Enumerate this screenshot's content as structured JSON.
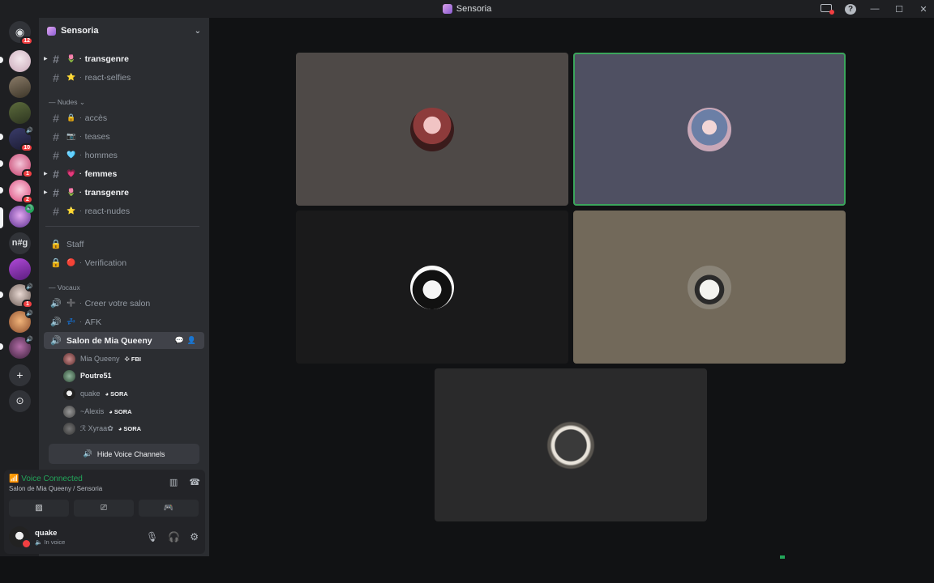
{
  "window": {
    "title": "Sensoria"
  },
  "server": {
    "name": "Sensoria"
  },
  "guild_badges": [
    "12",
    "10",
    "1",
    "2",
    "1"
  ],
  "guild_text_label": "n#g",
  "channels": [
    {
      "name": "transgenre",
      "emoji": "🌷",
      "bold": true,
      "arrow": true
    },
    {
      "name": "react-selfies",
      "emoji": "⭐",
      "bold": false,
      "arrow": false
    }
  ],
  "category_nudes": "Nudes",
  "nudes_channels": [
    {
      "name": "accès",
      "emoji": "🔒",
      "bold": false,
      "arrow": false
    },
    {
      "name": "teases",
      "emoji": "📷",
      "bold": false,
      "arrow": false
    },
    {
      "name": "hommes",
      "emoji": "🩵",
      "bold": false,
      "arrow": false
    },
    {
      "name": "femmes",
      "emoji": "💗",
      "bold": true,
      "arrow": true
    },
    {
      "name": "transgenre",
      "emoji": "🌷",
      "bold": true,
      "arrow": true
    },
    {
      "name": "react-nudes",
      "emoji": "⭐",
      "bold": false,
      "arrow": false
    }
  ],
  "locked_channels": [
    {
      "name": "Staff",
      "emoji": ""
    },
    {
      "name": "Verification",
      "emoji": "🔴"
    }
  ],
  "category_vocaux": "Vocaux",
  "voice_channels": [
    {
      "name": "Creer votre salon",
      "emoji": "➕"
    },
    {
      "name": "AFK",
      "emoji": "💤"
    }
  ],
  "active_voice": {
    "name": "Salon de Mia Queeny"
  },
  "voice_users": [
    {
      "name": "Mia Queeny",
      "tag": "FBI",
      "bold": false
    },
    {
      "name": "Poutre51",
      "tag": "",
      "bold": true
    },
    {
      "name": "quake",
      "tag": "SORA",
      "bold": false
    },
    {
      "name": "~Alexis",
      "tag": "SORA",
      "bold": false
    },
    {
      "name": "ℛ Xyraa✿",
      "tag": "SORA",
      "bold": false
    }
  ],
  "hide_voice_channels": "Hide Voice Channels",
  "voice_panel": {
    "status": "Voice Connected",
    "location": "Salon de Mia Queeny / Sensoria"
  },
  "user": {
    "name": "quake",
    "status": "In voice"
  },
  "icons": {
    "titlebar": [
      "inbox-icon",
      "help-icon",
      "minimize-icon",
      "maximize-icon",
      "close-icon"
    ],
    "voice_panel": [
      "noise-suppression-icon",
      "disconnect-icon",
      "camera-off-icon",
      "screen-share-icon",
      "activity-icon"
    ],
    "user_panel": [
      "microphone-icon",
      "headphones-icon",
      "settings-icon"
    ]
  },
  "colors": {
    "accent_green": "#23a55a",
    "badge_red": "#f23f42",
    "tile_1": "#4e4947",
    "tile_2": "#4f5062",
    "tile_3": "#1a1a1b",
    "tile_4": "#72695a",
    "tile_5": "#2a2a2b"
  }
}
